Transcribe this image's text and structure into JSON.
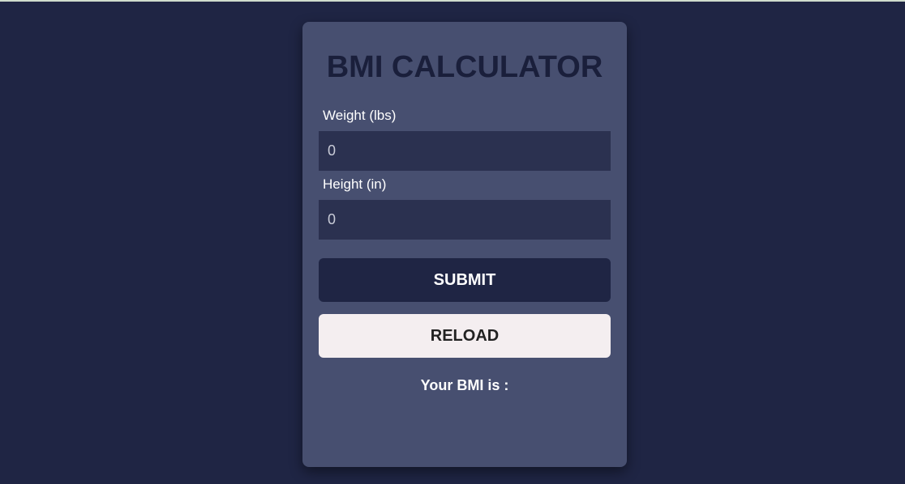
{
  "app": {
    "title": "BMI CALCULATOR"
  },
  "form": {
    "weight": {
      "label": "Weight (lbs)",
      "placeholder": "0",
      "value": ""
    },
    "height": {
      "label": "Height (in)",
      "placeholder": "0",
      "value": ""
    }
  },
  "buttons": {
    "submit_label": "SUBMIT",
    "reload_label": "RELOAD"
  },
  "result": {
    "text": "Your BMI is :"
  },
  "colors": {
    "page_background": "#1f2544",
    "card_background": "#474f70",
    "input_background": "#2b3150",
    "submit_background": "#1f2544",
    "reload_background": "#f4eef0",
    "title_color": "#1a1f3b"
  }
}
